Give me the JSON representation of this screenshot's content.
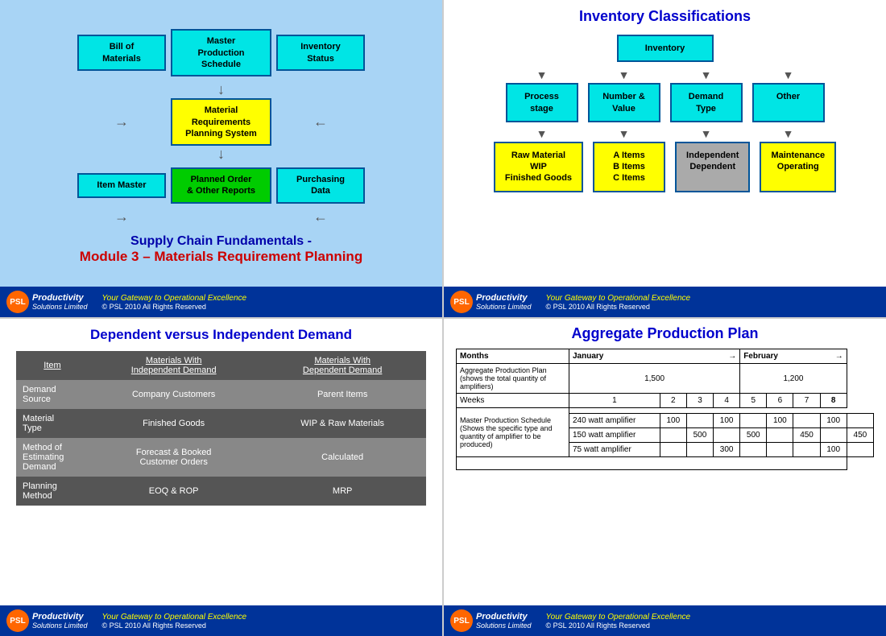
{
  "slide1": {
    "boxes": {
      "bill_of_materials": "Bill of\nMaterials",
      "master_production": "Master\nProduction\nSchedule",
      "inventory_status": "Inventory\nStatus",
      "item_master": "Item Master",
      "mrp_system": "Material\nRequirements\nPlanning System",
      "purchasing_data": "Purchasing\nData",
      "planned_order": "Planned Order\n& Other Reports"
    },
    "title_line1": "Supply Chain Fundamentals -",
    "title_line2": "Module 3 – Materials Requirement Planning",
    "footer": {
      "company": "Productivity\nSolutions Limited",
      "tagline": "Your Gateway to Operational Excellence",
      "copyright": "© PSL 2010 All Rights Reserved"
    }
  },
  "slide2": {
    "title": "Inventory Classifications",
    "top_box": "Inventory",
    "row1": [
      "Process\nstage",
      "Number &\nValue",
      "Demand\nType",
      "Other"
    ],
    "row2_yellow": [
      "Raw Material\nWIP\nFinished Goods",
      "A Items\nB Items\nC Items"
    ],
    "row2_gray": [
      "Independent\nDependent"
    ],
    "row2_yellow2": [
      "Maintenance\nOperating"
    ],
    "footer": {
      "company": "Productivity\nSolutions Limited",
      "tagline": "Your Gateway to Operational Excellence",
      "copyright": "© PSL 2010 All Rights Reserved"
    }
  },
  "slide3": {
    "title": "Dependent versus Independent Demand",
    "table": {
      "headers": [
        "Item",
        "Materials With\nIndependent Demand",
        "Materials With\nDependent Demand"
      ],
      "rows": [
        [
          "Demand\nSource",
          "Company Customers",
          "Parent Items"
        ],
        [
          "Material\nType",
          "Finished Goods",
          "WIP & Raw Materials"
        ],
        [
          "Method of\nEstimating\nDemand",
          "Forecast & Booked\nCustomer Orders",
          "Calculated"
        ],
        [
          "Planning\nMethod",
          "EOQ & ROP",
          "MRP"
        ]
      ]
    },
    "footer": {
      "company": "Productivity\nSolutions Limited",
      "tagline": "Your Gateway to Operational Excellence",
      "copyright": "© PSL 2010 All Rights Reserved"
    }
  },
  "slide4": {
    "title": "Aggregate Production Plan",
    "months_header": "Months",
    "jan_header": "January",
    "feb_header": "February",
    "agg_plan_label": "Aggregate Production Plan\n(shows the total quantity of\namplifiers)",
    "jan_qty": "1,500",
    "feb_qty": "1,200",
    "weeks_label": "Weeks",
    "week_numbers": [
      "1",
      "2",
      "3",
      "4",
      "5",
      "6",
      "7",
      "8"
    ],
    "mps_label": "Master Production Schedule\n(Shows the specific type and\nquantity of amplifier to be\nproduced)",
    "products": [
      {
        "name": "240 watt amplifier",
        "values": [
          "100",
          "",
          "100",
          "",
          "100",
          "",
          "100",
          ""
        ]
      },
      {
        "name": "150 watt amplifier",
        "values": [
          "",
          "500",
          "",
          "500",
          "",
          "450",
          "",
          "450"
        ]
      },
      {
        "name": "75 watt amplifier",
        "values": [
          "",
          "",
          "300",
          "",
          "",
          "",
          "100",
          ""
        ]
      }
    ],
    "footer": {
      "company": "Productivity\nSolutions Limited",
      "tagline": "Your Gateway to Operational Excellence",
      "copyright": "© PSL 2010 All Rights Reserved"
    }
  }
}
